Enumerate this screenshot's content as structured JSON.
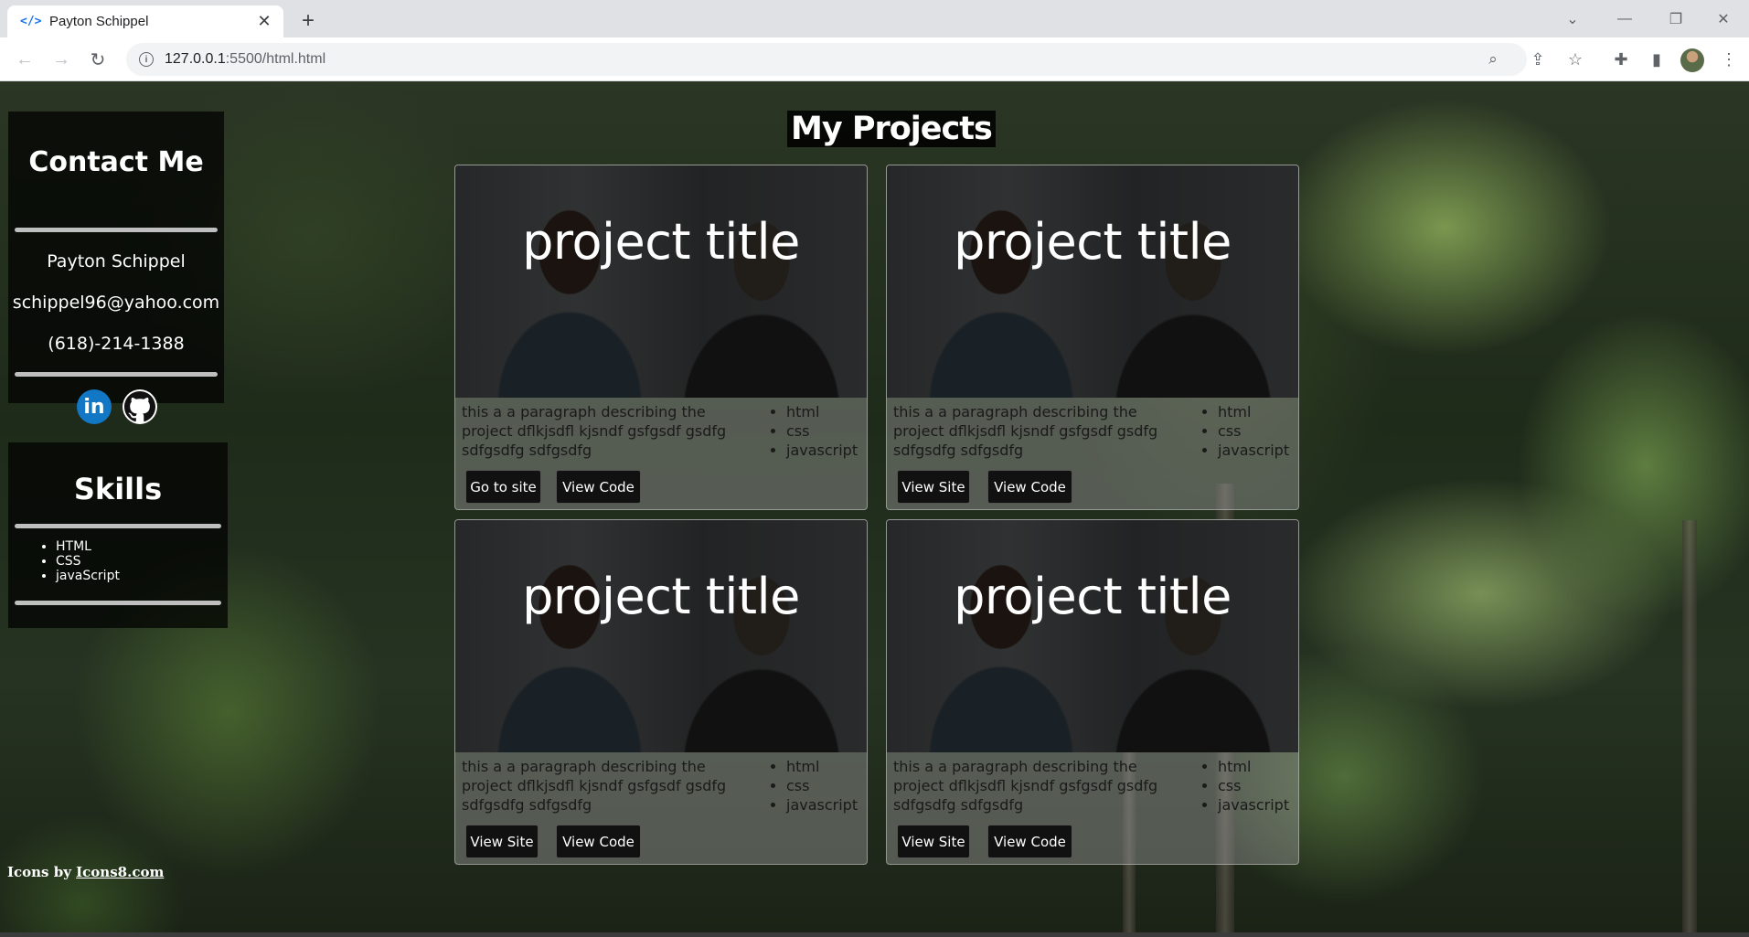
{
  "browser": {
    "tab_title": "Payton Schippel",
    "favicon": "</>",
    "url_host": "127.0.0.1",
    "url_path": ":5500/html.html"
  },
  "sidebar": {
    "contact": {
      "heading": "Contact Me",
      "name": "Payton Schippel",
      "email": "schippel96@yahoo.com",
      "phone": "(618)-214-1388",
      "linkedin_label": "in"
    },
    "skills": {
      "heading": "Skills",
      "items": [
        "HTML",
        "CSS",
        "javaScript"
      ]
    },
    "credit_prefix": "Icons by ",
    "credit_link": "Icons8.com"
  },
  "main": {
    "heading": "My Projects",
    "projects": [
      {
        "title": "project title",
        "description": "this a a paragraph describing the project dflkjsdfl kjsndf gsfgsdf gsdfg sdfgsdfg sdfgsdfg",
        "tech": [
          "html",
          "css",
          "javascript"
        ],
        "site_button": "Go to site",
        "code_button": "View Code"
      },
      {
        "title": "project title",
        "description": "this a a paragraph describing the project dflkjsdfl kjsndf gsfgsdf gsdfg sdfgsdfg sdfgsdfg",
        "tech": [
          "html",
          "css",
          "javascript"
        ],
        "site_button": "View Site",
        "code_button": "View Code"
      },
      {
        "title": "project title",
        "description": "this a a paragraph describing the project dflkjsdfl kjsndf gsfgsdf gsdfg sdfgsdfg sdfgsdfg",
        "tech": [
          "html",
          "css",
          "javascript"
        ],
        "site_button": "View Site",
        "code_button": "View Code"
      },
      {
        "title": "project title",
        "description": "this a a paragraph describing the project dflkjsdfl kjsndf gsfgsdf gsdfg sdfgsdfg sdfgsdfg",
        "tech": [
          "html",
          "css",
          "javascript"
        ],
        "site_button": "View Site",
        "code_button": "View Code"
      }
    ]
  },
  "colors": {
    "panel_bg": "#000000",
    "linkedin_blue": "#1277c4",
    "button_bg": "#111111"
  },
  "icons": [
    "code-favicon-icon",
    "close-icon",
    "plus-icon",
    "back-icon",
    "forward-icon",
    "reload-icon",
    "info-icon",
    "zoom-icon",
    "share-icon",
    "star-icon",
    "extensions-icon",
    "sidepanel-icon",
    "menu-icon",
    "linkedin-icon",
    "github-icon"
  ]
}
